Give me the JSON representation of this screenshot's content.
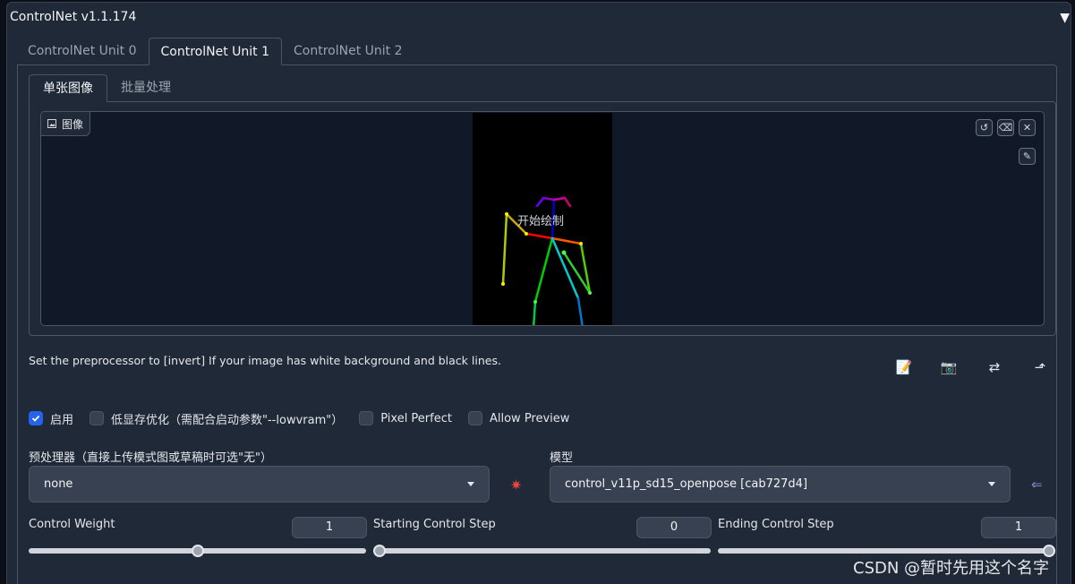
{
  "panel": {
    "title": "ControlNet v1.1.174",
    "collapse_glyph": "▼"
  },
  "unit_tabs": [
    "ControlNet Unit 0",
    "ControlNet Unit 1",
    "ControlNet Unit 2"
  ],
  "active_unit_tab": "ControlNet Unit 1",
  "image_tabs": [
    "单张图像",
    "批量处理"
  ],
  "active_image_tab": "单张图像",
  "image_input": {
    "label": "图像",
    "canvas_overlay_text": "开始绘制",
    "buttons": [
      "undo-icon",
      "erase-icon",
      "close-icon",
      "brush-icon"
    ]
  },
  "hint": "Set the preprocessor to [invert] If your image has white background and black lines.",
  "tool_icons": [
    "edit-icon",
    "camera-icon",
    "swap-icon",
    "send-dimensions-icon"
  ],
  "checkboxes": [
    {
      "label": "启用",
      "checked": true
    },
    {
      "label": "低显存优化（需配合启动参数\"--lowvram\"）",
      "checked": false
    },
    {
      "label": "Pixel Perfect",
      "checked": false
    },
    {
      "label": "Allow Preview",
      "checked": false
    }
  ],
  "preprocessor": {
    "label": "预处理器（直接上传模式图或草稿时可选\"无\"）",
    "value": "none",
    "run_icon": "explosion-icon"
  },
  "model": {
    "label": "模型",
    "value": "control_v11p_sd15_openpose [cab727d4]",
    "refresh_icon": "refresh-models-icon"
  },
  "sliders": [
    {
      "label": "Control Weight",
      "value": "1",
      "min": 0,
      "max": 2,
      "fraction": 0.5
    },
    {
      "label": "Starting Control Step",
      "value": "0",
      "min": 0,
      "max": 1,
      "fraction": 0.0
    },
    {
      "label": "Ending Control Step",
      "value": "1",
      "min": 0,
      "max": 1,
      "fraction": 1.0
    }
  ],
  "watermark": "CSDN @暂时先用这个名字",
  "colors": {
    "accent": "#2563eb",
    "panel_bg": "#1f2937",
    "page_bg": "#0b0f19"
  }
}
